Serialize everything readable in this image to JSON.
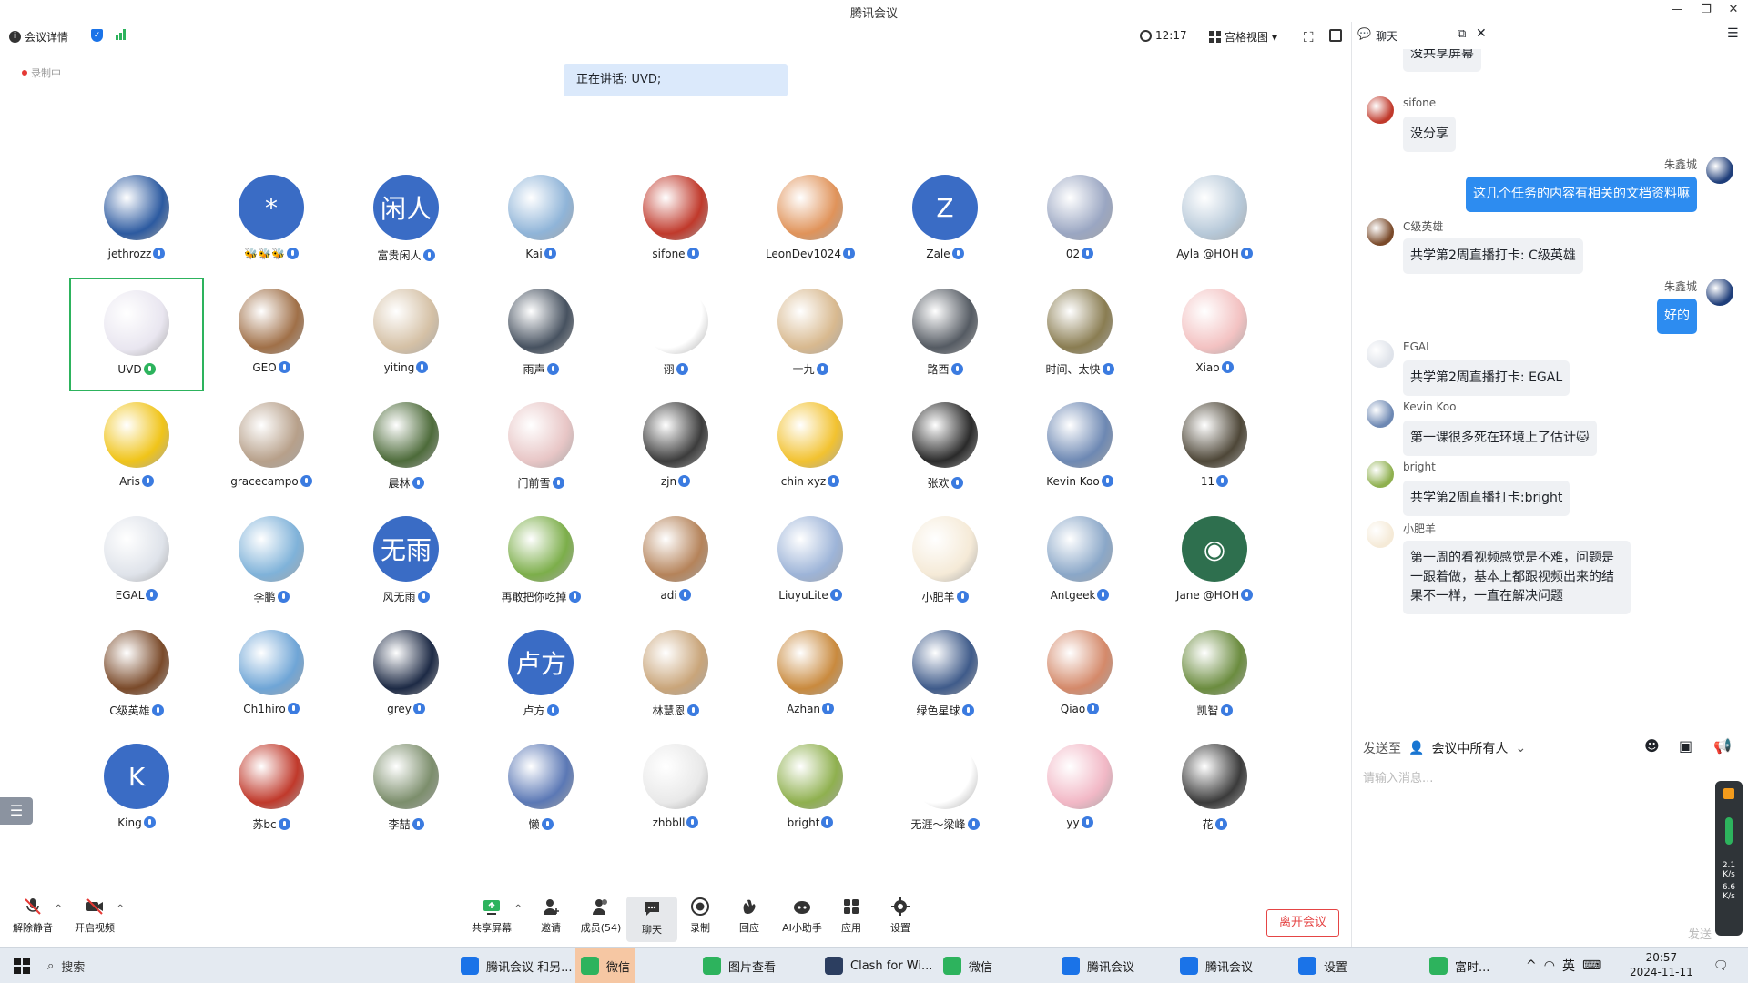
{
  "window": {
    "title": "腾讯会议"
  },
  "toolbar": {
    "meeting_details": "会议详情",
    "time": "12:17",
    "view_mode": "宫格视图"
  },
  "recording_label": "录制中",
  "speaking_banner": "正在讲话: UVD;",
  "participants": [
    {
      "name": "jethrozz",
      "type": "img",
      "color": "#2c5aa0"
    },
    {
      "name": "🐝🐝🐝",
      "type": "text",
      "text": "*",
      "color": "#3a6cc5"
    },
    {
      "name": "富贵闲人",
      "type": "text",
      "text": "闲人",
      "color": "#3a6cc5"
    },
    {
      "name": "Kai",
      "type": "img",
      "color": "#8fb4d8"
    },
    {
      "name": "sifone",
      "type": "img",
      "color": "#c0392b"
    },
    {
      "name": "LeonDev1024",
      "type": "img",
      "color": "#e0935a"
    },
    {
      "name": "Zale",
      "type": "text",
      "text": "Z",
      "color": "#3a6cc5"
    },
    {
      "name": "02",
      "type": "img",
      "color": "#9aa6c2"
    },
    {
      "name": "Ayla @HOH",
      "type": "img",
      "color": "#b7c9d9"
    },
    {
      "name": "UVD",
      "type": "img",
      "color": "#e9e6f0",
      "active": true
    },
    {
      "name": "GEO",
      "type": "img",
      "color": "#a07048"
    },
    {
      "name": "yiting",
      "type": "img",
      "color": "#d5c1a6"
    },
    {
      "name": "雨声",
      "type": "img",
      "color": "#475260"
    },
    {
      "name": "诩",
      "type": "img",
      "color": "#ffffff"
    },
    {
      "name": "十九",
      "type": "img",
      "color": "#d8b98f"
    },
    {
      "name": "路西",
      "type": "img",
      "color": "#555b63"
    },
    {
      "name": "时间、太快",
      "type": "img",
      "color": "#8a7d52"
    },
    {
      "name": "Xiao",
      "type": "img",
      "color": "#f3c2c2"
    },
    {
      "name": "Aris",
      "type": "img",
      "color": "#f0c419"
    },
    {
      "name": "gracecampo",
      "type": "img",
      "color": "#b7a08a"
    },
    {
      "name": "晨林",
      "type": "img",
      "color": "#4d6b3a"
    },
    {
      "name": "门前雪",
      "type": "img",
      "color": "#e8c6c6"
    },
    {
      "name": "zjn",
      "type": "img",
      "color": "#3c3c3c"
    },
    {
      "name": "chin xyz",
      "type": "img",
      "color": "#f2c230"
    },
    {
      "name": "张欢",
      "type": "img",
      "color": "#2a2a2a"
    },
    {
      "name": "Kevin Koo",
      "type": "img",
      "color": "#6d88b3"
    },
    {
      "name": "11",
      "type": "img",
      "color": "#4e4738"
    },
    {
      "name": "EGAL",
      "type": "img",
      "color": "#dfe3ea"
    },
    {
      "name": "李鹏",
      "type": "img",
      "color": "#7fb2d9"
    },
    {
      "name": "风无雨",
      "type": "text",
      "text": "无雨",
      "color": "#3a6cc5"
    },
    {
      "name": "再敢把你吃掉",
      "type": "img",
      "color": "#7cae4a"
    },
    {
      "name": "adi",
      "type": "img",
      "color": "#b5835a"
    },
    {
      "name": "LiuyuLite",
      "type": "img",
      "color": "#9db4d8"
    },
    {
      "name": "小肥羊",
      "type": "img",
      "color": "#f5ead7"
    },
    {
      "name": "Antgeek",
      "type": "img",
      "color": "#8aa7c8"
    },
    {
      "name": "Jane @HOH",
      "type": "text",
      "text": "◉",
      "color": "#2e6f4e"
    },
    {
      "name": "C级英雄",
      "type": "img",
      "color": "#7a4a2a"
    },
    {
      "name": "Ch1hiro",
      "type": "img",
      "color": "#6fa5d6"
    },
    {
      "name": "grey",
      "type": "img",
      "color": "#1d2a45"
    },
    {
      "name": "卢方",
      "type": "text",
      "text": "卢方",
      "color": "#3a6cc5"
    },
    {
      "name": "林慧恩",
      "type": "img",
      "color": "#c9a57a"
    },
    {
      "name": "Azhan",
      "type": "img",
      "color": "#c98a3e"
    },
    {
      "name": "绿色星球",
      "type": "img",
      "color": "#3f5b8a"
    },
    {
      "name": "Qiao",
      "type": "img",
      "color": "#d4896a"
    },
    {
      "name": "凯智",
      "type": "img",
      "color": "#6b8c3f"
    },
    {
      "name": "King",
      "type": "text",
      "text": "K",
      "color": "#3a6cc5"
    },
    {
      "name": "苏bc",
      "type": "img",
      "color": "#c0392b"
    },
    {
      "name": "李喆",
      "type": "img",
      "color": "#7c8e6c"
    },
    {
      "name": "懒",
      "type": "img",
      "color": "#5b78b5"
    },
    {
      "name": "zhbbll",
      "type": "img",
      "color": "#e9e9e9"
    },
    {
      "name": "bright",
      "type": "img",
      "color": "#8fb04f"
    },
    {
      "name": "无涯～梁峰",
      "type": "img",
      "color": "#ffffff"
    },
    {
      "name": "yy",
      "type": "img",
      "color": "#f2b8c6"
    },
    {
      "name": "花",
      "type": "img",
      "color": "#3b3b3b"
    }
  ],
  "bottom": {
    "unmute": "解除静音",
    "start_video": "开启视频",
    "share_screen": "共享屏幕",
    "invite": "邀请",
    "members": "成员(54)",
    "chat": "聊天",
    "record": "录制",
    "react": "回应",
    "ai_assistant": "AI小助手",
    "apps": "应用",
    "settings": "设置",
    "leave": "离开会议"
  },
  "chat": {
    "title": "聊天",
    "send_to_label": "发送至",
    "send_to_value": "会议中所有人",
    "placeholder": "请输入消息...",
    "send": "发送",
    "messages": [
      {
        "sender": "",
        "text": "没共享屏幕",
        "self": false,
        "color": "#dfe3ea"
      },
      {
        "sender": "sifone",
        "text": "没分享",
        "self": false,
        "color": "#c0392b"
      },
      {
        "sender": "朱鑫城",
        "text": "这几个任务的内容有相关的文档资料嘛",
        "self": true,
        "color": "#1f3e7a"
      },
      {
        "sender": "C级英雄",
        "text": "共学第2周直播打卡: C级英雄",
        "self": false,
        "color": "#7a4a2a"
      },
      {
        "sender": "朱鑫城",
        "text": "好的",
        "self": true,
        "color": "#1f3e7a"
      },
      {
        "sender": "EGAL",
        "text": "共学第2周直播打卡: EGAL",
        "self": false,
        "color": "#dfe3ea"
      },
      {
        "sender": "Kevin Koo",
        "text": "第一课很多死在环境上了估计🐱",
        "self": false,
        "color": "#6d88b3"
      },
      {
        "sender": "bright",
        "text": "共学第2周直播打卡:bright",
        "self": false,
        "color": "#8fb04f"
      },
      {
        "sender": "小肥羊",
        "text": "第一周的看视频感觉是不难，问题是一跟着做，基本上都跟视频出来的结果不一样，一直在解决问题",
        "self": false,
        "color": "#f5ead7"
      }
    ]
  },
  "side_widget": {
    "up": "2.1",
    "up_unit": "K/s",
    "down": "6.6",
    "down_unit": "K/s"
  },
  "taskbar": {
    "search": "搜索",
    "items": [
      "腾讯会议 和另...",
      "微信",
      "图片查看",
      "Clash for Wi...",
      "微信",
      "腾讯会议",
      "腾讯会议",
      "设置",
      "富时..."
    ],
    "ime": "英",
    "time": "20:57",
    "date": "2024-11-11"
  }
}
